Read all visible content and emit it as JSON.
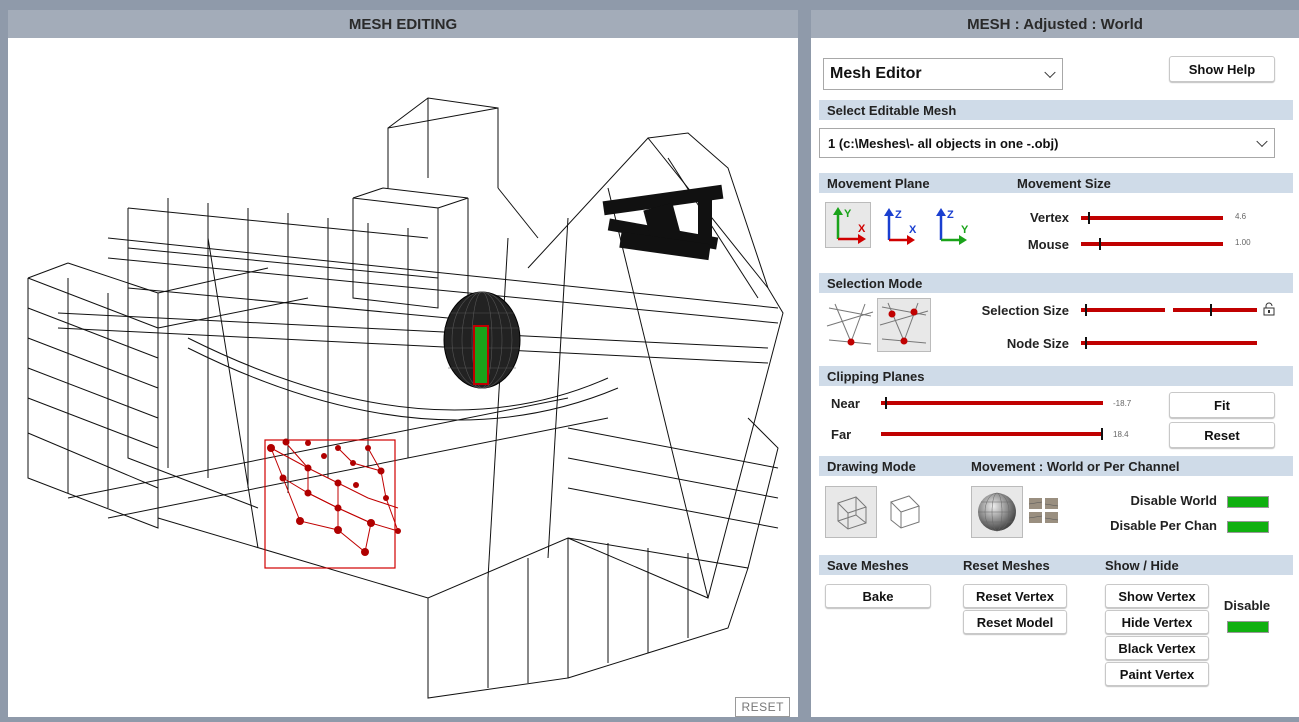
{
  "left_panel": {
    "title": "MESH EDITING",
    "reset_label": "RESET"
  },
  "right_panel": {
    "title": "MESH : Adjusted : World",
    "editor_select": {
      "value": "Mesh Editor"
    },
    "show_help_label": "Show Help",
    "select_mesh": {
      "header": "Select Editable Mesh",
      "value": "1 (c:\\Meshes\\- all objects in one -.obj)"
    },
    "movement": {
      "plane_header": "Movement Plane",
      "size_header": "Movement Size",
      "vertex_label": "Vertex",
      "vertex_value": "4.6",
      "vertex_level": 0.02,
      "mouse_label": "Mouse",
      "mouse_value": "1.00",
      "mouse_level": 0.1,
      "plane_icons": [
        "yx-plane-icon",
        "zx-plane-icon",
        "zy-plane-icon"
      ],
      "axis_labels": {
        "y": "Y",
        "x": "X",
        "z": "Z"
      }
    },
    "selection": {
      "header": "Selection Mode",
      "size_label": "Selection Size",
      "node_label": "Node Size",
      "size_level_a": 0.0,
      "size_level_b": 0.4,
      "node_level": 0.0
    },
    "clipping": {
      "header": "Clipping Planes",
      "near_label": "Near",
      "near_value": "-18.7",
      "near_level": 0.0,
      "far_label": "Far",
      "far_value": "18.4",
      "far_level": 1.0,
      "fit_label": "Fit",
      "reset_label": "Reset"
    },
    "drawing": {
      "header": "Drawing Mode",
      "movement_header": "Movement : World or Per Channel",
      "disable_world": "Disable World",
      "disable_per_chan": "Disable Per Chan"
    },
    "save": {
      "header": "Save Meshes",
      "bake_label": "Bake"
    },
    "reset_meshes": {
      "header": "Reset Meshes",
      "reset_vertex": "Reset Vertex",
      "reset_model": "Reset Model"
    },
    "show_hide": {
      "header": "Show / Hide",
      "show_vertex": "Show Vertex",
      "hide_vertex": "Hide Vertex",
      "black_vertex": "Black Vertex",
      "paint_vertex": "Paint Vertex",
      "disable_label": "Disable"
    },
    "colors": {
      "accent_red": "#c00000",
      "toggle_green": "#10b010",
      "header_bg": "#cfdbe8",
      "title_bg": "#a3acb9"
    }
  }
}
